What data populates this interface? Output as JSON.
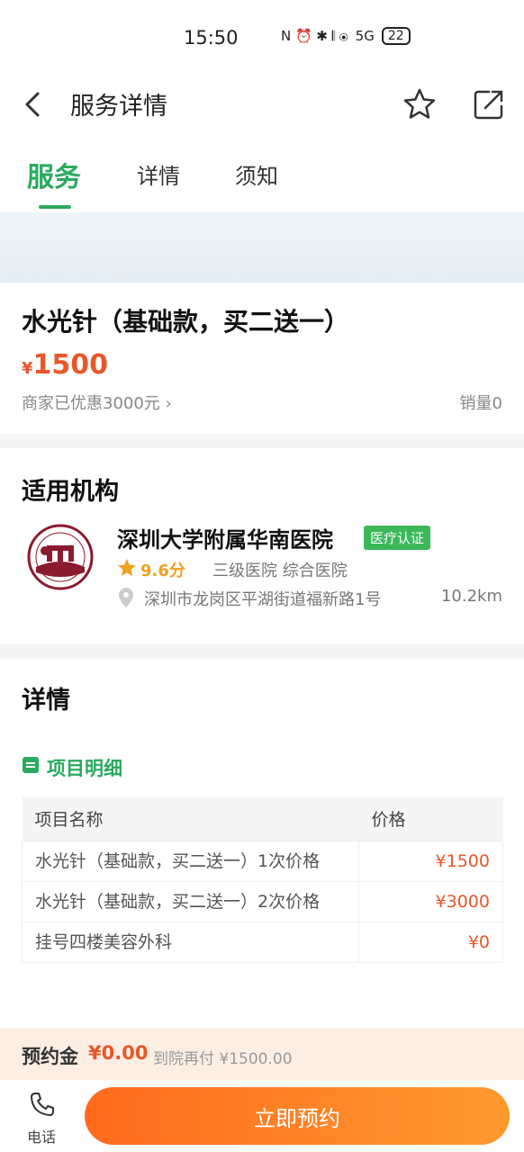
{
  "status": {
    "time": "15:50",
    "icons": "N ⏰ ✱ 𝄃 ⦿",
    "network": "5G",
    "battery": "22"
  },
  "nav": {
    "title": "服务详情"
  },
  "tabs": [
    {
      "label": "服务"
    },
    {
      "label": "详情"
    },
    {
      "label": "须知"
    }
  ],
  "product": {
    "title": "水光针（基础款，买二送一）",
    "currency": "¥",
    "price": "1500",
    "discount": "商家已优惠3000元 ›",
    "sales": "销量0"
  },
  "institution": {
    "section_title": "适用机构",
    "name": "深圳大学附属华南医院",
    "badge": "医疗认证",
    "rating": "9.6分",
    "type": "三级医院 综合医院",
    "address": "深圳市龙岗区平湖街道福新路1号",
    "distance": "10.2km"
  },
  "detail": {
    "section_title": "详情",
    "sub_title": "项目明细",
    "headers": [
      "项目名称",
      "价格"
    ],
    "rows": [
      {
        "name": "水光针（基础款，买二送一）1次价格",
        "price": "¥1500"
      },
      {
        "name": "水光针（基础款，买二送一）2次价格",
        "price": "¥3000"
      },
      {
        "name": "挂号四楼美容外科",
        "price": "¥0"
      }
    ]
  },
  "deposit": {
    "label": "预约金",
    "amount": "¥0.00",
    "rest": "到院再付 ¥1500.00"
  },
  "bottom": {
    "phone_label": "电话",
    "book_label": "立即预约"
  },
  "colors": {
    "accent_green": "#2aaa5e",
    "price_orange": "#e8572a",
    "button_start": "#ff6a1e",
    "button_end": "#ff9a2e"
  }
}
